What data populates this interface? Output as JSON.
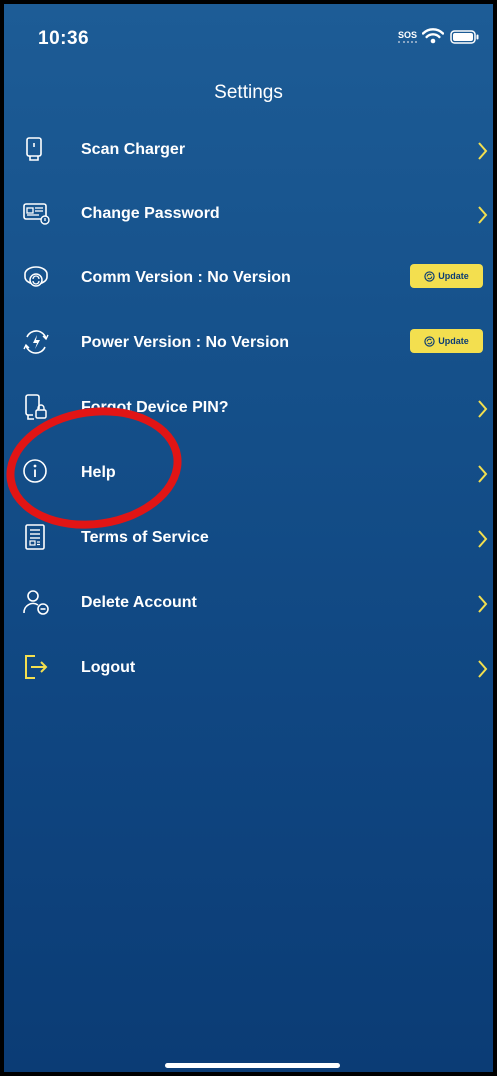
{
  "status_bar": {
    "time": "10:36",
    "sos": "SOS",
    "wifi_icon": "wifi-icon",
    "battery_icon": "battery-icon"
  },
  "header": {
    "title": "Settings"
  },
  "accent": {
    "highlight": "#f3df4f",
    "background": "#15508a",
    "annotation": "#e11515"
  },
  "menu": [
    {
      "label": "Scan Charger",
      "icon": "charger-icon"
    },
    {
      "label": "Change Password",
      "icon": "id-card-icon"
    },
    {
      "label": "Comm Version : No Version",
      "icon": "router-sync-icon",
      "action": "Update"
    },
    {
      "label": "Power Version : No Version",
      "icon": "power-sync-icon",
      "action": "Update"
    },
    {
      "label": "Forgot Device PIN?",
      "icon": "device-lock-icon"
    },
    {
      "label": "Help",
      "icon": "info-icon"
    },
    {
      "label": "Terms of Service",
      "icon": "document-icon"
    },
    {
      "label": "Delete Account",
      "icon": "user-remove-icon"
    },
    {
      "label": "Logout",
      "icon": "logout-icon"
    }
  ]
}
